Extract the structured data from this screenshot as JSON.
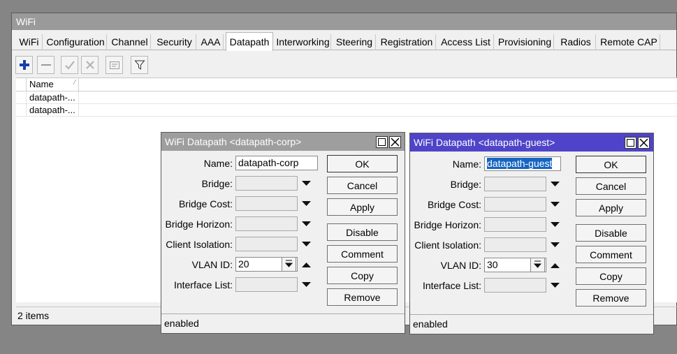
{
  "window": {
    "title": "WiFi"
  },
  "tabs": [
    "WiFi",
    "Configuration",
    "Channel",
    "Security",
    "AAA",
    "Datapath",
    "Interworking",
    "Steering",
    "Registration",
    "Access List",
    "Provisioning",
    "Radios",
    "Remote CAP"
  ],
  "active_tab": "Datapath",
  "toolbar": [
    "add-icon",
    "remove-icon",
    "enable-icon",
    "disable-icon",
    "comment-icon",
    "filter-icon"
  ],
  "table": {
    "columns": [
      "Name"
    ],
    "rows": [
      [
        "datapath-..."
      ],
      [
        "datapath-..."
      ]
    ]
  },
  "status": {
    "items": "2 items"
  },
  "dialogs": [
    {
      "title": "WiFi Datapath <datapath-corp>",
      "labels": [
        "Name:",
        "Bridge:",
        "Bridge Cost:",
        "Bridge Horizon:",
        "Client Isolation:",
        "VLAN ID:",
        "Interface List:"
      ],
      "name_value": "datapath-corp",
      "vlan_value": "20",
      "buttons": [
        "OK",
        "Cancel",
        "Apply",
        "Disable",
        "Comment",
        "Copy",
        "Remove"
      ],
      "status": "enabled"
    },
    {
      "title": "WiFi Datapath <datapath-guest>",
      "labels": [
        "Name:",
        "Bridge:",
        "Bridge Cost:",
        "Bridge Horizon:",
        "Client Isolation:",
        "VLAN ID:",
        "Interface List:"
      ],
      "name_value": "datapath-guest",
      "vlan_value": "30",
      "buttons": [
        "OK",
        "Cancel",
        "Apply",
        "Disable",
        "Comment",
        "Copy",
        "Remove"
      ],
      "status": "enabled"
    }
  ],
  "colors": {
    "active_title": "#4f44c9",
    "inactive_title": "#9e9e9e",
    "desktop": "#858585",
    "selection": "#1565c0"
  }
}
